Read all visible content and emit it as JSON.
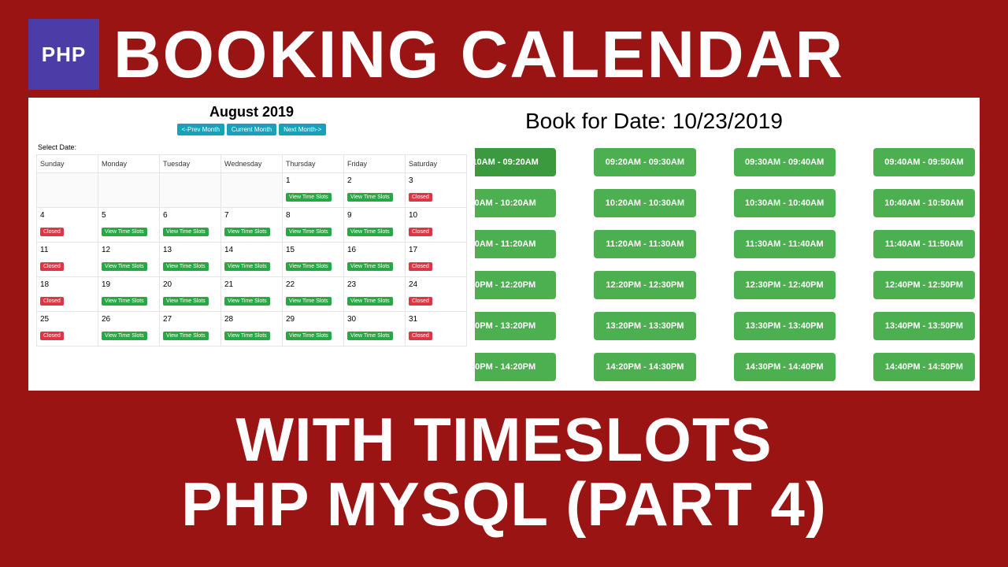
{
  "header": {
    "badge": "PHP",
    "title": "BOOKING CALENDAR"
  },
  "calendar": {
    "month_label": "August 2019",
    "nav": {
      "prev": "<-Prev Month",
      "current": "Current Month",
      "next": "Next Month->"
    },
    "select_date_label": "Select Date:",
    "weekdays": [
      "Sunday",
      "Monday",
      "Tuesday",
      "Wednesday",
      "Thursday",
      "Friday",
      "Saturday"
    ],
    "view_label": "View Time Slots",
    "closed_label": "Closed",
    "skip": 4,
    "days": [
      {
        "n": "1",
        "t": "view"
      },
      {
        "n": "2",
        "t": "view"
      },
      {
        "n": "3",
        "t": "closed"
      },
      {
        "n": "4",
        "t": "closed"
      },
      {
        "n": "5",
        "t": "view"
      },
      {
        "n": "6",
        "t": "view"
      },
      {
        "n": "7",
        "t": "view"
      },
      {
        "n": "8",
        "t": "view"
      },
      {
        "n": "9",
        "t": "view"
      },
      {
        "n": "10",
        "t": "closed"
      },
      {
        "n": "11",
        "t": "closed"
      },
      {
        "n": "12",
        "t": "view"
      },
      {
        "n": "13",
        "t": "view"
      },
      {
        "n": "14",
        "t": "view"
      },
      {
        "n": "15",
        "t": "view"
      },
      {
        "n": "16",
        "t": "view"
      },
      {
        "n": "17",
        "t": "closed"
      },
      {
        "n": "18",
        "t": "closed"
      },
      {
        "n": "19",
        "t": "view"
      },
      {
        "n": "20",
        "t": "view"
      },
      {
        "n": "21",
        "t": "view"
      },
      {
        "n": "22",
        "t": "view"
      },
      {
        "n": "23",
        "t": "view"
      },
      {
        "n": "24",
        "t": "closed"
      },
      {
        "n": "25",
        "t": "closed"
      },
      {
        "n": "26",
        "t": "view"
      },
      {
        "n": "27",
        "t": "view"
      },
      {
        "n": "28",
        "t": "view"
      },
      {
        "n": "29",
        "t": "view"
      },
      {
        "n": "30",
        "t": "view"
      },
      {
        "n": "31",
        "t": "closed"
      }
    ]
  },
  "booking": {
    "title": "Book for Date: 10/23/2019",
    "slots": [
      [
        "10AM - 09:20AM",
        "09:20AM - 09:30AM",
        "09:30AM - 09:40AM",
        "09:40AM - 09:50AM"
      ],
      [
        "0AM - 10:20AM",
        "10:20AM - 10:30AM",
        "10:30AM - 10:40AM",
        "10:40AM - 10:50AM"
      ],
      [
        "0AM - 11:20AM",
        "11:20AM - 11:30AM",
        "11:30AM - 11:40AM",
        "11:40AM - 11:50AM"
      ],
      [
        "0PM - 12:20PM",
        "12:20PM - 12:30PM",
        "12:30PM - 12:40PM",
        "12:40PM - 12:50PM"
      ],
      [
        "0PM - 13:20PM",
        "13:20PM - 13:30PM",
        "13:30PM - 13:40PM",
        "13:40PM - 13:50PM"
      ],
      [
        "0PM - 14:20PM",
        "14:20PM - 14:30PM",
        "14:30PM - 14:40PM",
        "14:40PM - 14:50PM"
      ]
    ]
  },
  "footer": {
    "line1": "WITH TIMESLOTS",
    "line2": "PHP MYSQL (PART 4)"
  }
}
